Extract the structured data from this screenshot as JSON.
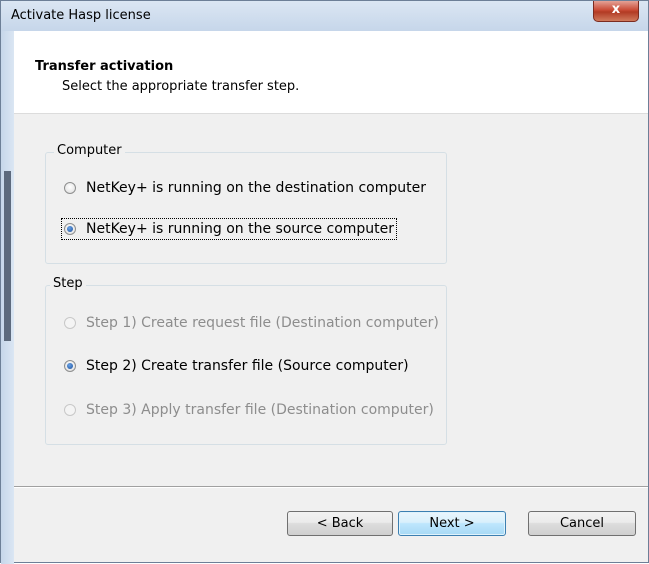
{
  "window": {
    "title": "Activate Hasp license",
    "close_glyph": "x"
  },
  "header": {
    "title": "Transfer activation",
    "subtitle": "Select the appropriate transfer step."
  },
  "computer_group": {
    "label": "Computer",
    "options": [
      {
        "label": "NetKey+ is running on the destination computer",
        "checked": false,
        "enabled": true
      },
      {
        "label": "NetKey+ is running on the source computer",
        "checked": true,
        "enabled": true
      }
    ]
  },
  "step_group": {
    "label": "Step",
    "options": [
      {
        "label": "Step 1) Create request file (Destination computer)",
        "checked": false,
        "enabled": false
      },
      {
        "label": "Step 2) Create transfer file (Source computer)",
        "checked": true,
        "enabled": true
      },
      {
        "label": "Step 3) Apply transfer file (Destination computer)",
        "checked": false,
        "enabled": false
      }
    ]
  },
  "buttons": {
    "back": "< Back",
    "next": "Next >",
    "cancel": "Cancel"
  },
  "colors": {
    "disabled_text": "#8d8d8d",
    "close_button": "#c94b36",
    "default_button_border": "#3c7fb1"
  }
}
